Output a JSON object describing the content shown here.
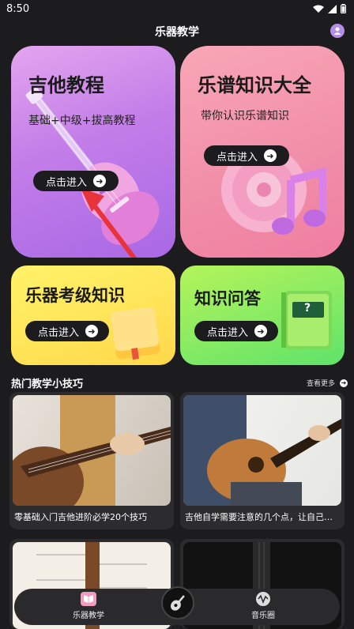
{
  "status": {
    "time": "8:50"
  },
  "header": {
    "title": "乐器教学",
    "profile_icon": "user-icon"
  },
  "cards": {
    "guitar": {
      "title": "吉他教程",
      "subtitle": "基础+中级+拔高教程",
      "button": "点击进入"
    },
    "score": {
      "title": "乐谱知识大全",
      "subtitle": "带你认识乐谱知识",
      "button": "点击进入"
    },
    "exam": {
      "title": "乐器考级知识",
      "button": "点击进入"
    },
    "qa": {
      "title": "知识问答",
      "button": "点击进入",
      "book_label": "?"
    }
  },
  "tips": {
    "title": "热门教学小技巧",
    "more": "查看更多",
    "items": [
      {
        "caption": "零基础入门吉他进阶必学20个技巧"
      },
      {
        "caption": "吉他自学需要注意的几个点，让自己练习..."
      }
    ]
  },
  "nav": {
    "items": [
      {
        "label": "乐器教学",
        "icon": "book-icon"
      },
      {
        "label": "音乐圈",
        "icon": "waveform-icon"
      }
    ],
    "center_icon": "guitar-icon"
  },
  "colors": {
    "background": "#1c1c1e",
    "guitar_card": "#c27de8",
    "score_card": "#f18fa9",
    "exam_card": "#ffd84a",
    "qa_card": "#7ee866"
  }
}
